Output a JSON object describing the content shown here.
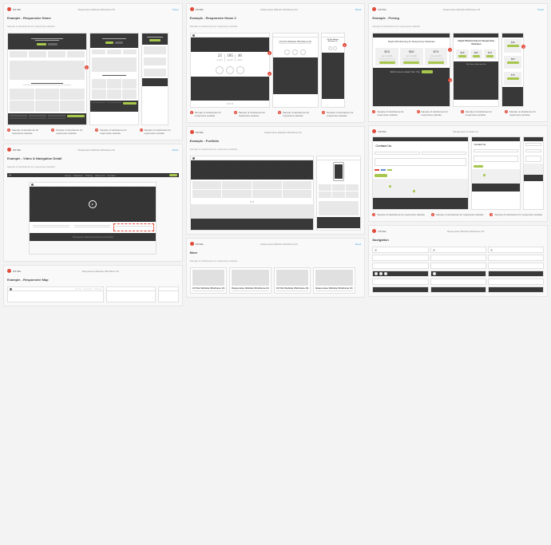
{
  "brand": "UX Kits",
  "kit_title": "Responsive Website Wireframe Kit",
  "social": {
    "twitter": "Tweet",
    "fb": "Share"
  },
  "col1": {
    "example_home": {
      "title": "Example - Responsive Home",
      "sub": "Sample of wireframes for responsive website"
    },
    "example_video": {
      "title": "Example - Video & Navigation Detail",
      "sub": "Sample of wireframes for responsive website"
    },
    "example_map": {
      "title": "Example - Responsive Map"
    },
    "nav": {
      "items": [
        "Home",
        "Features",
        "Pricing",
        "About Us",
        "Contact"
      ],
      "button": "Sign Up"
    },
    "quote": "\"Someone referenced what something\""
  },
  "col2": {
    "example_home2": {
      "title": "Example - Responsive Home 2",
      "sub": "Sample of wireframes for responsive website"
    },
    "stats": [
      {
        "num": "23",
        "label": "lorem"
      },
      {
        "num": "185",
        "label": "ipsum"
      },
      {
        "num": "46",
        "label": "dolor"
      }
    ],
    "card_title": "UX Kits Website Wireframe Kit",
    "card_sub": "Sample of wireframes for responsive website",
    "example_portfolio": {
      "title": "Example - Portfolio",
      "sub": "Sample of wireframes for responsive website"
    },
    "more": {
      "title": "More",
      "sub": "Sample of wireframes for responsive website"
    },
    "more_cards": [
      "UX Kits Website Wireframe Kit",
      "Responsive Website Wireframe Kit",
      "UX Kits Website Wireframe Kit",
      "Responsive Website Wireframe Kit"
    ]
  },
  "col3": {
    "example_pricing": {
      "title": "Example - Pricing",
      "sub": "Sample of wireframes for responsive website"
    },
    "pricing_headline": "Rapid Wireframing for Responsive Websites",
    "prices": [
      "$25",
      "$50",
      "$75"
    ],
    "price_period": "per month",
    "cta1": "We'd Love to Hear from You",
    "cta2": "We'd Love to Hear from You",
    "contact": {
      "title": "Responsive Contact Us",
      "heading": "Contact Us",
      "button": "Submit"
    },
    "navigation": {
      "title": "Navigation"
    }
  },
  "annotations": [
    "1",
    "2",
    "3",
    "4"
  ]
}
